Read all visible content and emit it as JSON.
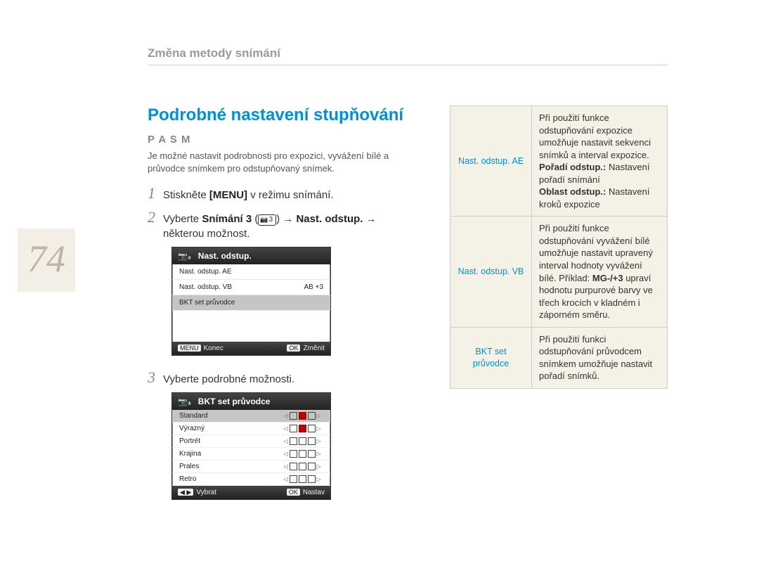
{
  "page_number": "74",
  "breadcrumb": "Změna metody snímání",
  "title": "Podrobné nastavení stupňování",
  "modes": "P A S M",
  "intro": "Je možné nastavit podrobnosti pro expozici, vyvážení bílé a průvodce snímkem pro odstupňovaný snímek.",
  "steps": {
    "s1": {
      "pre": "Stiskněte ",
      "menu": "[MENU]",
      "post": " v režimu snímání."
    },
    "s2": {
      "pre": "Vyberte ",
      "bold1": "Snímání 3",
      "badge": "3",
      "arrow": " → ",
      "bold2": "Nast. odstup.",
      "post": " → některou možnost."
    },
    "s3": "Vyberte podrobné možnosti."
  },
  "lcd1": {
    "title": "Nast. odstup.",
    "rows": [
      {
        "label": "Nast. odstup. AE",
        "val": ""
      },
      {
        "label": "Nast. odstup. VB",
        "val": "AB    +3"
      },
      {
        "label": "BKT set průvodce",
        "val": "",
        "sel": true
      }
    ],
    "foot_left_key": "MENU",
    "foot_left": "Konec",
    "foot_right_key": "OK",
    "foot_right": "Změnit"
  },
  "lcd2": {
    "title": "BKT set průvodce",
    "rows": [
      {
        "label": "Standard",
        "checks": [
          false,
          true,
          false
        ],
        "sel": true
      },
      {
        "label": "Výrazný",
        "checks": [
          false,
          true,
          false
        ]
      },
      {
        "label": "Portrét",
        "checks": [
          false,
          false,
          false
        ]
      },
      {
        "label": "Krajina",
        "checks": [
          false,
          false,
          false
        ]
      },
      {
        "label": "Prales",
        "checks": [
          false,
          false,
          false
        ]
      },
      {
        "label": "Retro",
        "checks": [
          false,
          false,
          false
        ]
      }
    ],
    "foot_left_arrows": "◀ ▶",
    "foot_left": "Vybrat",
    "foot_right_key": "OK",
    "foot_right": "Nastav"
  },
  "table": {
    "r1": {
      "key": "Nast. odstup. AE",
      "line1": "Při použití funkce odstupňování expozice umožňuje nastavit sekvenci snímků a interval expozice.",
      "b1": "Pořadí odstup.:",
      "b1t": " Nastavení pořadí snímání",
      "b2": "Oblast odstup.:",
      "b2t": " Nastavení kroků expozice"
    },
    "r2": {
      "key": "Nast. odstup. VB",
      "line1": "Při použití funkce odstupňování vyvážení bílé umožňuje nastavit upravený interval hodnoty vyvážení bílé. Příklad: ",
      "b1": "MG-/+3",
      "b1t": " upraví hodnotu purpurové barvy ve třech krocích v kladném i záporném směru."
    },
    "r3": {
      "key": "BKT set průvodce",
      "line1": "Při použití funkci odstupňování průvodcem snímkem umožňuje nastavit pořadí snímků."
    }
  }
}
